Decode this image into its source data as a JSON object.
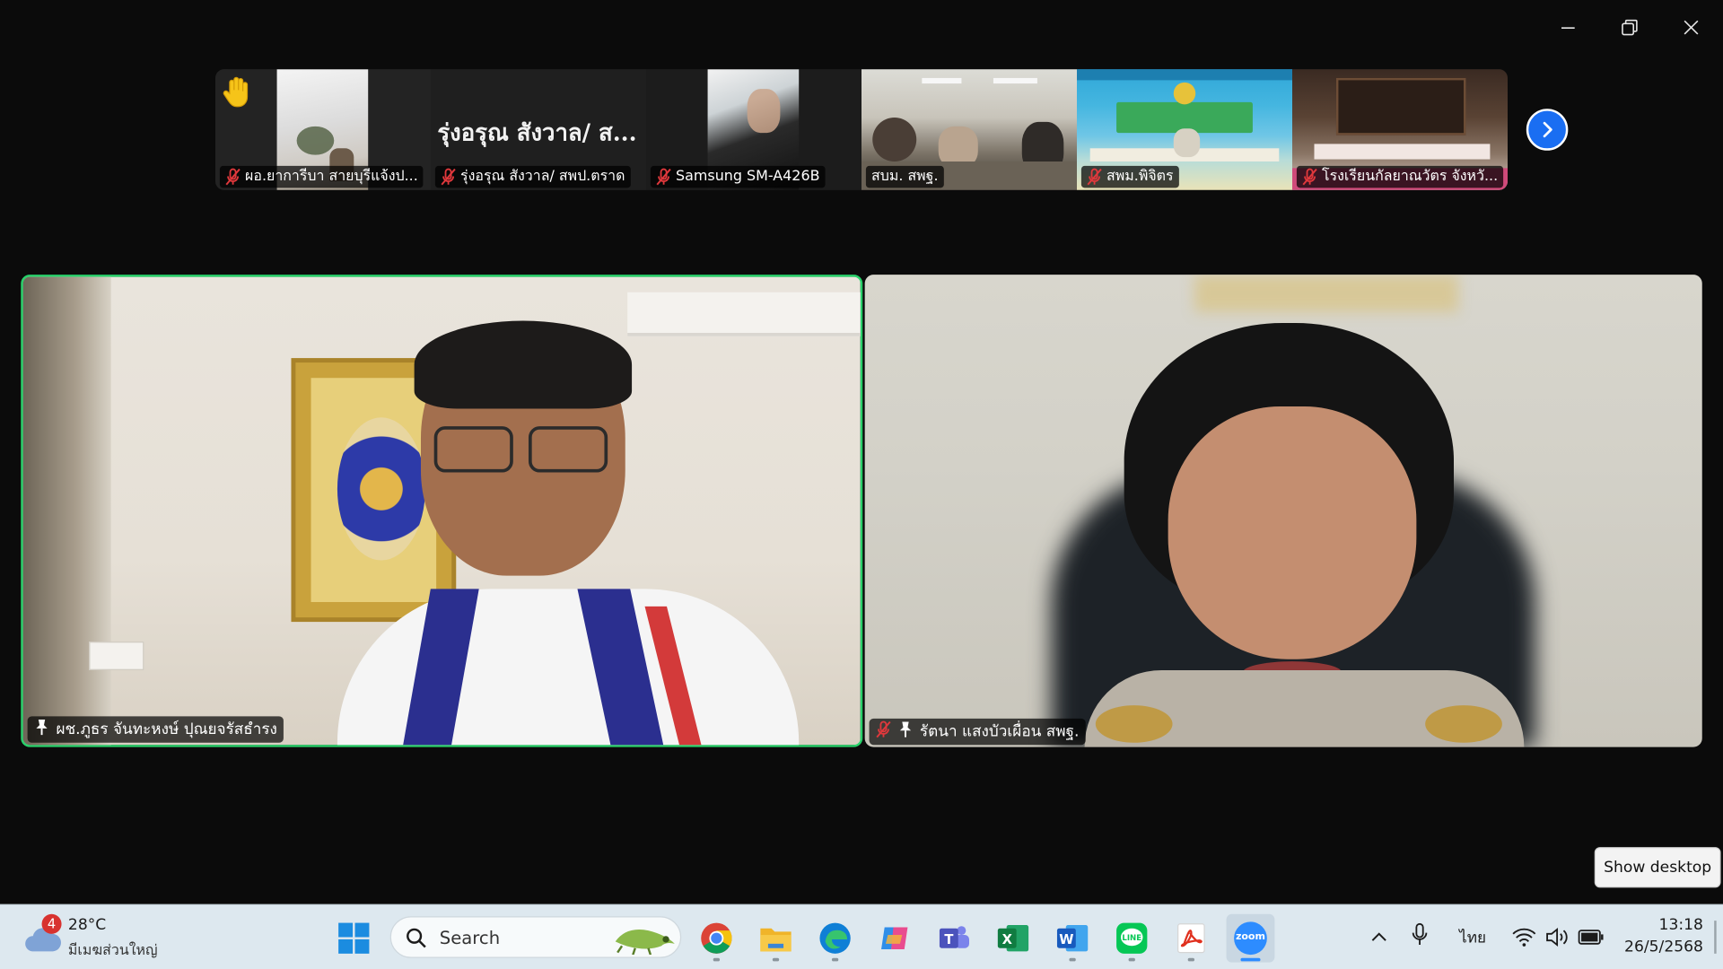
{
  "window": {
    "minimize_icon": "minimize-icon",
    "restore_icon": "restore-icon",
    "close_icon": "close-icon"
  },
  "thumbnails": [
    {
      "name": "ผอ.ยาการีบา  สายบุรีแจ้งป...",
      "muted": true,
      "raised_hand": true
    },
    {
      "name": "รุ่งอรุณ สังวาล/ สพป.ตราด",
      "muted": true,
      "big_name": "รุ่งอรุณ สังวาล/ ส..."
    },
    {
      "name": "Samsung SM-A426B",
      "muted": true
    },
    {
      "name": "สบม. สพฐ.",
      "muted": false
    },
    {
      "name": "สพม.พิจิตร",
      "muted": true
    },
    {
      "name": "โรงเรียนกัลยาณวัตร จังหวั...",
      "muted": true
    }
  ],
  "next_page_icon": "chevron-right-icon",
  "gallery": {
    "left": {
      "name": "ผช.ภูธร จันทะหงษ์ ปุณยจรัสธำรง",
      "pinned": true,
      "active_speaker": true
    },
    "right": {
      "name": "รัตนา แสงบัวเผื่อน สพฐ.",
      "pinned": true,
      "muted": true
    }
  },
  "show_desktop_label": "Show desktop",
  "taskbar": {
    "weather": {
      "badge": "4",
      "temp": "28°C",
      "condition": "มีเมฆส่วนใหญ่"
    },
    "search_placeholder": "Search",
    "apps": [
      "windows-start",
      "chrome",
      "file-explorer",
      "edge",
      "copilot",
      "teams",
      "excel",
      "word",
      "line",
      "acrobat",
      "zoom"
    ],
    "zoom_label": "zoom",
    "language": "ไทย",
    "time": "13:18",
    "date": "26/5/2568"
  },
  "colors": {
    "active_speaker_border": "#28d16a",
    "next_button": "#1a6ef2",
    "taskbar_bg": "#dde8ef",
    "muted_icon": "#e0383c"
  }
}
